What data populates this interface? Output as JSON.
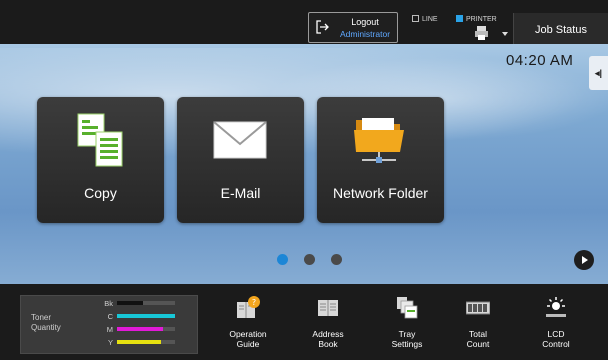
{
  "topbar": {
    "logout_label": "Logout",
    "user": "Administrator",
    "indicators": [
      {
        "label": "LINE",
        "active": false
      },
      {
        "label": "PRINTER",
        "active": true
      }
    ],
    "job_status_label": "Job Status"
  },
  "main": {
    "clock": "04:20 AM",
    "side_tab_glyph": "◂|",
    "tiles": [
      {
        "label": "Copy",
        "icon": "copy-icon"
      },
      {
        "label": "E-Mail",
        "icon": "envelope-icon"
      },
      {
        "label": "Network Folder",
        "icon": "network-folder-icon"
      }
    ],
    "pager": {
      "count": 3,
      "active": 1
    }
  },
  "bottombar": {
    "toner": {
      "title_line1": "Toner",
      "title_line2": "Quantity",
      "levels": [
        {
          "label": "Bk",
          "level": 0.45,
          "color": "#111111"
        },
        {
          "label": "C",
          "level": 1.0,
          "color": "#18c8d8"
        },
        {
          "label": "M",
          "level": 0.8,
          "color": "#e21ad8"
        },
        {
          "label": "Y",
          "level": 0.75,
          "color": "#e6e010"
        }
      ]
    },
    "tools": [
      {
        "label": "Operation\nGuide",
        "icon": "operation-guide-icon"
      },
      {
        "label": "Address\nBook",
        "icon": "address-book-icon"
      },
      {
        "label": "Tray\nSettings",
        "icon": "tray-settings-icon"
      },
      {
        "label": "Total\nCount",
        "icon": "total-count-icon"
      },
      {
        "label": "LCD\nControl",
        "icon": "lcd-control-icon"
      }
    ]
  },
  "colors": {
    "accent": "#1c86d6",
    "user_text": "#5fa8ff",
    "active_indicator": "#2aa3e8"
  }
}
